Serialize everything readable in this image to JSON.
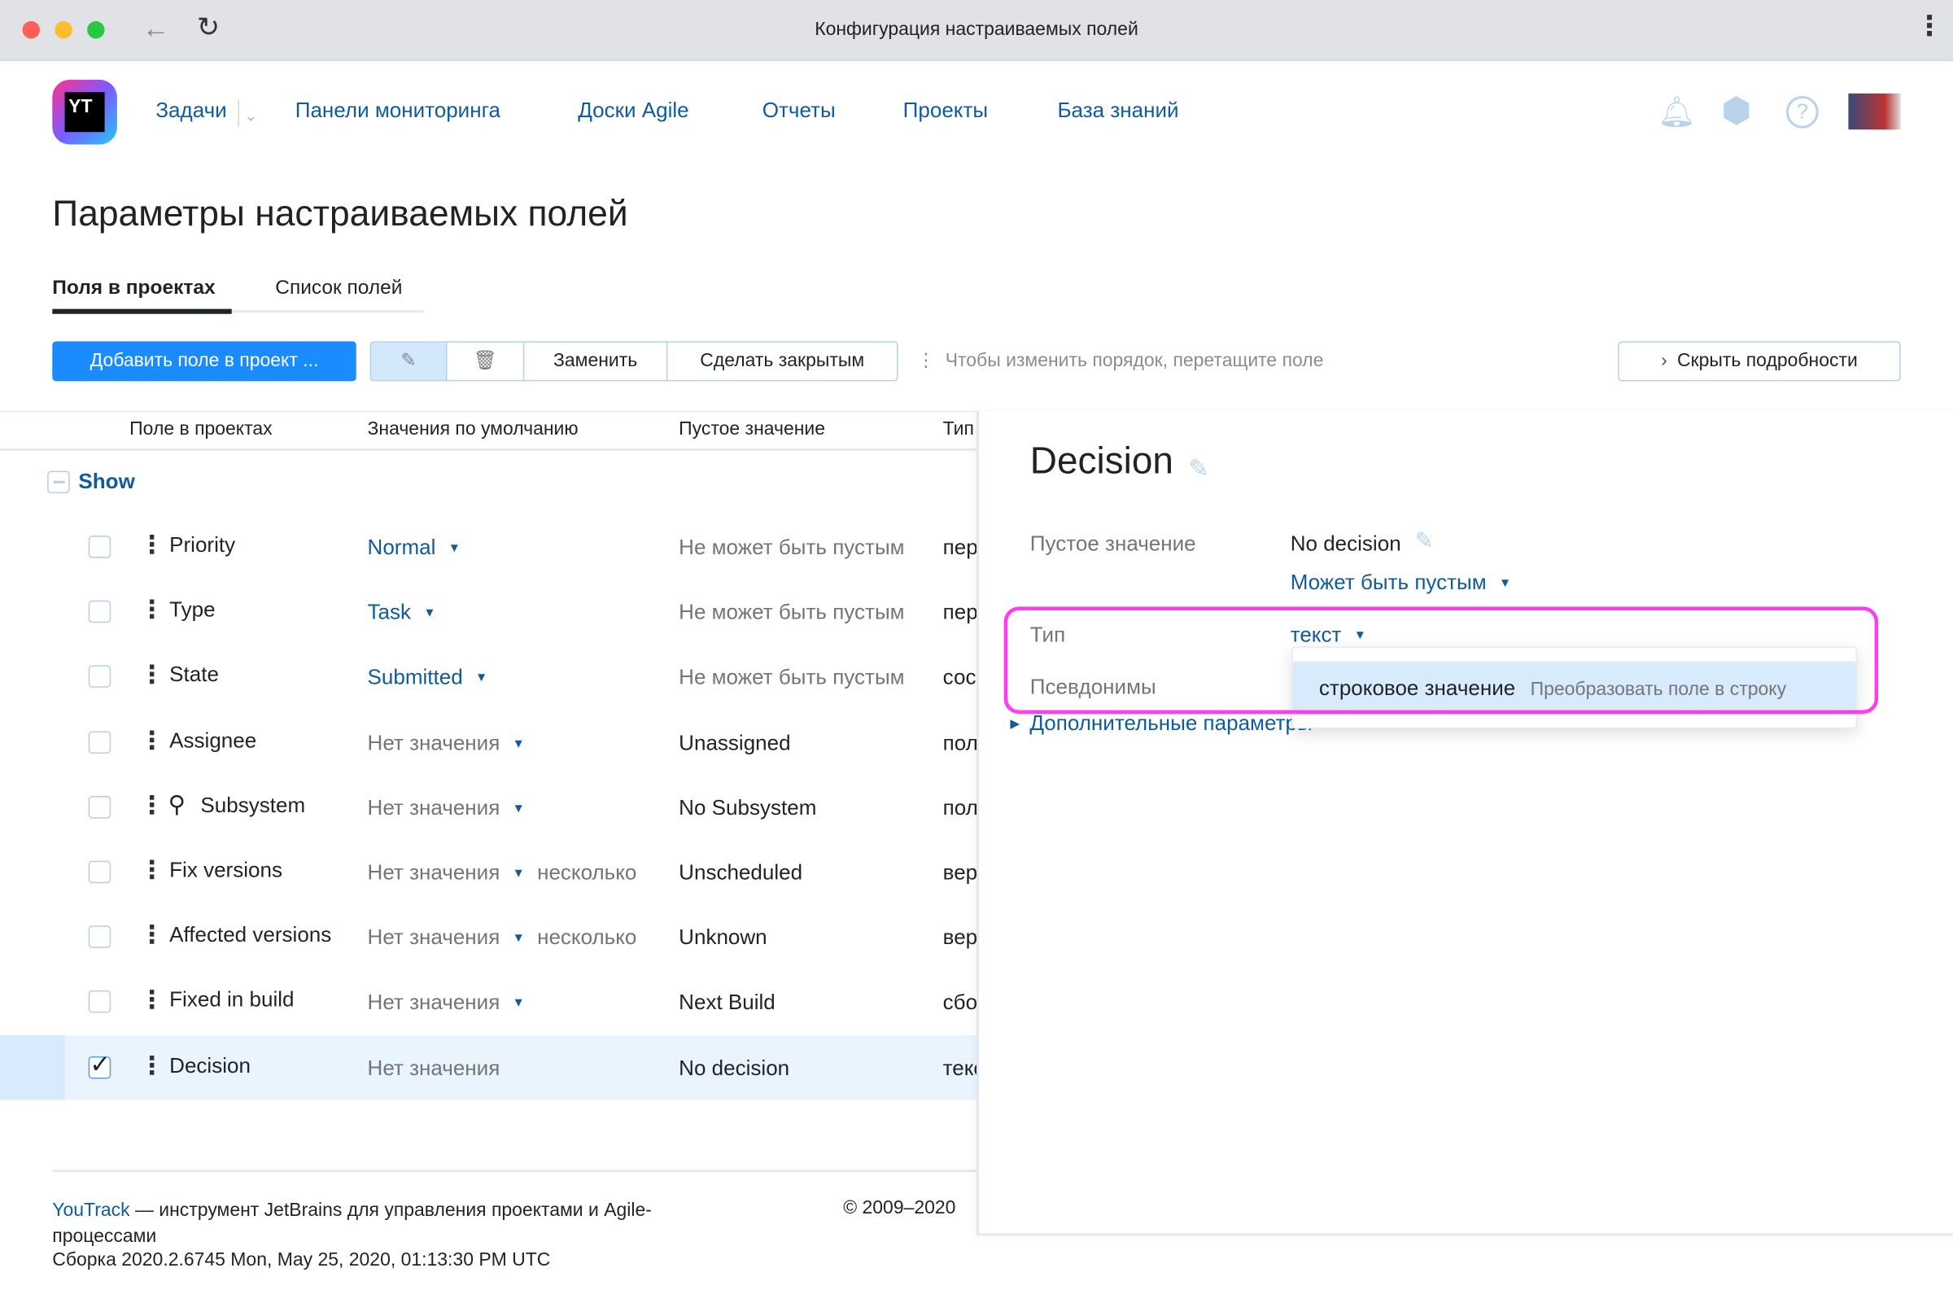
{
  "window": {
    "title": "Конфигурация настраиваемых полей"
  },
  "nav": {
    "items": [
      "Задачи",
      "Панели мониторинга",
      "Доски Agile",
      "Отчеты",
      "Проекты",
      "База знаний"
    ],
    "logo_text": "YT"
  },
  "page": {
    "title": "Параметры настраиваемых полей"
  },
  "tabs": [
    {
      "label": "Поля в проектах",
      "active": true
    },
    {
      "label": "Список полей",
      "active": false
    }
  ],
  "toolbar": {
    "add": "Добавить поле в проект ...",
    "replace": "Заменить",
    "make_private": "Сделать закрытым",
    "hint": "Чтобы изменить порядок, перетащите поле",
    "hide_details": "Скрыть подробности"
  },
  "table": {
    "headers": [
      "Поле в проектах",
      "Значения по умолчанию",
      "Пустое значение",
      "Тип"
    ],
    "group": "Show",
    "rows": [
      {
        "name": "Priority",
        "default": "Normal",
        "default_link": true,
        "multi": "",
        "empty": "Не может быть пустым",
        "empty_gray": true,
        "type": "перечисление",
        "checked": false,
        "dropdown": true
      },
      {
        "name": "Type",
        "default": "Task",
        "default_link": true,
        "multi": "",
        "empty": "Не может быть пустым",
        "empty_gray": true,
        "type": "перечисление",
        "checked": false,
        "dropdown": true
      },
      {
        "name": "State",
        "default": "Submitted",
        "default_link": true,
        "multi": "",
        "empty": "Не может быть пустым",
        "empty_gray": true,
        "type": "состояние",
        "checked": false,
        "dropdown": true
      },
      {
        "name": "Assignee",
        "default": "Нет значения",
        "default_link": false,
        "multi": "",
        "empty": "Unassigned",
        "empty_gray": false,
        "type": "пользователь",
        "checked": false,
        "dropdown": true
      },
      {
        "name": "Subsystem",
        "default": "Нет значения",
        "default_link": false,
        "multi": "",
        "empty": "No Subsystem",
        "empty_gray": false,
        "type": "пользователь",
        "checked": false,
        "dropdown": true,
        "icon": "owner-key-icon"
      },
      {
        "name": "Fix versions",
        "default": "Нет значения",
        "default_link": false,
        "multi": "несколько",
        "empty": "Unscheduled",
        "empty_gray": false,
        "type": "версия",
        "checked": false,
        "dropdown": true
      },
      {
        "name": "Affected versions",
        "default": "Нет значения",
        "default_link": false,
        "multi": "несколько",
        "empty": "Unknown",
        "empty_gray": false,
        "type": "версия",
        "checked": false,
        "dropdown": true
      },
      {
        "name": "Fixed in build",
        "default": "Нет значения",
        "default_link": false,
        "multi": "",
        "empty": "Next Build",
        "empty_gray": false,
        "type": "сборка",
        "checked": false,
        "dropdown": true
      },
      {
        "name": "Decision",
        "default": "Нет значения",
        "default_link": false,
        "multi": "",
        "empty": "No decision",
        "empty_gray": false,
        "type": "текст",
        "checked": true,
        "dropdown": false
      }
    ]
  },
  "detail": {
    "title": "Decision",
    "empty_label": "Пустое значение",
    "empty_value": "No decision",
    "can_be_empty": "Может быть пустым",
    "type_label": "Тип",
    "type_value": "текст",
    "aliases_label": "Псевдонимы",
    "advanced": "Дополнительные параметры",
    "dropdown": {
      "option": "строковое значение",
      "option_hint": "Преобразовать поле в строку"
    }
  },
  "footer": {
    "brand": "YouTrack",
    "text": " — инструмент JetBrains для управления проектами и Agile-процессами",
    "build": "Сборка 2020.2.6745 Mon, May 25, 2020, 01:13:30 PM UTC",
    "copyright": "© 2009–2020"
  },
  "colors": {
    "accent": "#1a8cff",
    "link": "#0f5b9e",
    "highlight": "#ff3cf0",
    "selected_row": "#eaf4fe"
  }
}
